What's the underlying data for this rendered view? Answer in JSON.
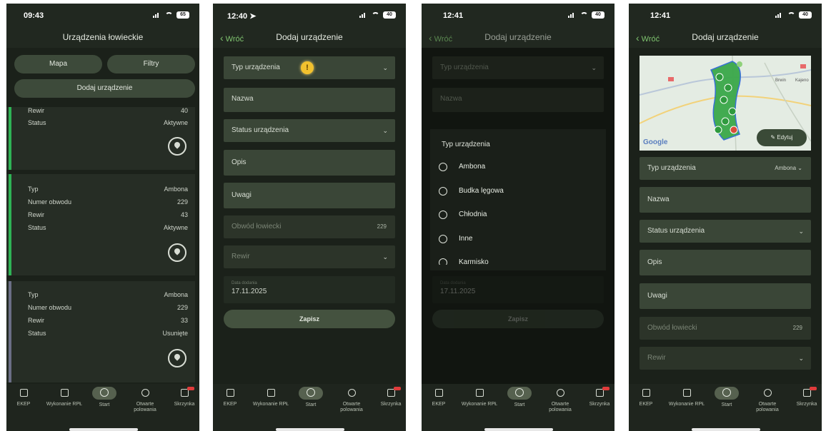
{
  "tabbar": {
    "items": [
      {
        "label": "EKEP",
        "icon": "book-icon"
      },
      {
        "label": "Wykonanie RPŁ",
        "icon": "calendar-check-icon"
      },
      {
        "label": "Start",
        "icon": "tree-icon"
      },
      {
        "label": "Otwarte polowania",
        "icon": "crosshair-icon"
      },
      {
        "label": "Skrzynka",
        "icon": "inbox-icon"
      }
    ]
  },
  "screen1": {
    "time": "09:43",
    "battery": "65",
    "title": "Urządzenia łowieckie",
    "btn_map": "Mapa",
    "btn_filters": "Filtry",
    "btn_add": "Dodaj urządzenie",
    "card0": {
      "rewir_label": "Rewir",
      "rewir_value": "40",
      "status_label": "Status",
      "status_value": "Aktywne",
      "bar_color": "#2fb355"
    },
    "card1": {
      "typ_label": "Typ",
      "typ_value": "Ambona",
      "numer_label": "Numer obwodu",
      "numer_value": "229",
      "rewir_label": "Rewir",
      "rewir_value": "43",
      "status_label": "Status",
      "status_value": "Aktywne",
      "bar_color": "#2fb355"
    },
    "card2": {
      "typ_label": "Typ",
      "typ_value": "Ambona",
      "numer_label": "Numer obwodu",
      "numer_value": "229",
      "rewir_label": "Rewir",
      "rewir_value": "33",
      "status_label": "Status",
      "status_value": "Usunięte",
      "bar_color": "#6b6f86"
    }
  },
  "screen2": {
    "time": "12:40",
    "battery": "40",
    "back": "Wróć",
    "title": "Dodaj urządzenie",
    "f_typ": "Typ urządzenia",
    "f_nazwa": "Nazwa",
    "f_status": "Status urządzenia",
    "f_opis": "Opis",
    "f_uwagi": "Uwagi",
    "f_obwod": "Obwód łowiecki",
    "f_obwod_value": "229",
    "f_rewir": "Rewir",
    "date_label": "Data dodania",
    "date_value": "17.11.2025",
    "save": "Zapisz",
    "warn_mark": "!"
  },
  "screen3": {
    "time": "12:41",
    "battery": "40",
    "back": "Wróć",
    "title": "Dodaj urządzenie",
    "f_typ": "Typ urządzenia",
    "f_nazwa": "Nazwa",
    "sheet_title": "Typ urządzenia",
    "options": [
      "Ambona",
      "Budka lęgowa",
      "Chłodnia",
      "Inne",
      "Karmisko"
    ],
    "date_label": "Data dodania",
    "date_value": "17.11.2025",
    "save": "Zapisz"
  },
  "screen4": {
    "time": "12:41",
    "battery": "40",
    "back": "Wróć",
    "title": "Dodaj urządzenie",
    "map_google": "Google",
    "map_town1": "Brwin",
    "map_town2": "Kajeno",
    "edit": "Edytuj",
    "f_typ": "Typ urządzenia",
    "f_typ_value": "Ambona",
    "f_nazwa": "Nazwa",
    "f_status": "Status urządzenia",
    "f_opis": "Opis",
    "f_uwagi": "Uwagi",
    "f_obwod": "Obwód łowiecki",
    "f_obwod_value": "229",
    "f_rewir": "Rewir"
  },
  "colors": {
    "bg": "#212820",
    "field": "#3a4637",
    "accent_green": "#7fc46f",
    "active_bar": "#2fb355",
    "removed_bar": "#6b6f86"
  }
}
